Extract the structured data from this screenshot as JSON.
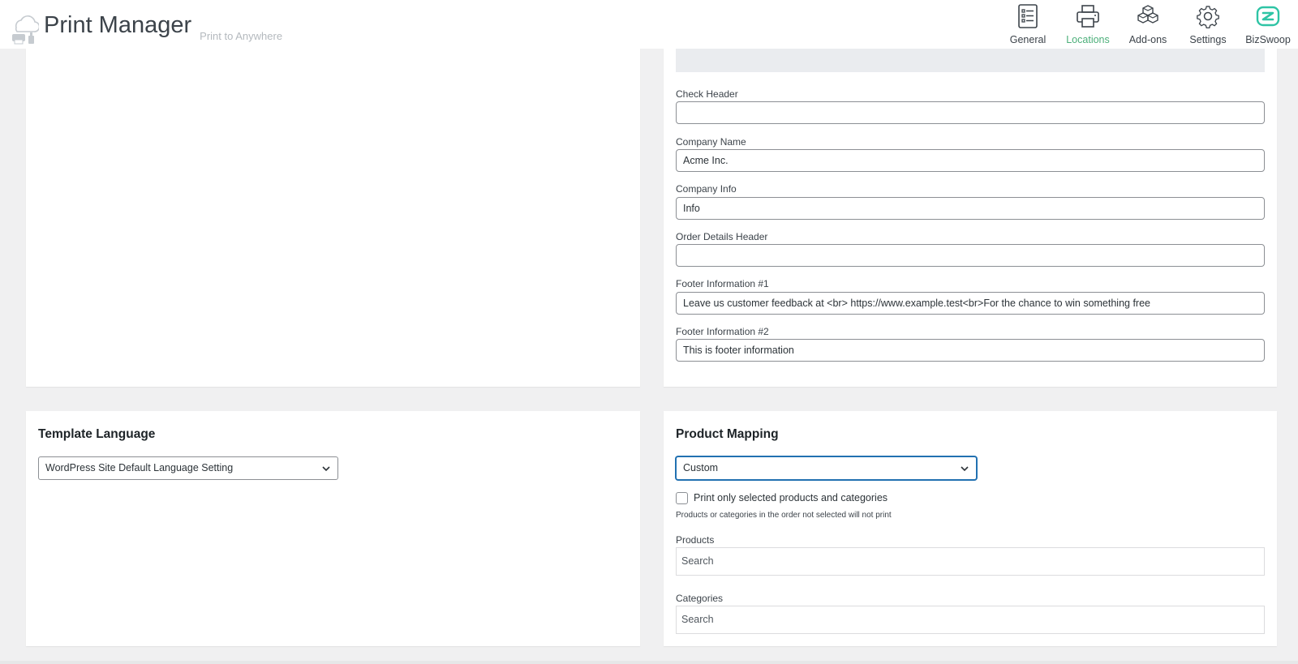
{
  "header": {
    "app_title": "Print Manager",
    "app_subtitle": "Print to Anywhere",
    "nav": [
      {
        "label": "General",
        "icon": "list-icon"
      },
      {
        "label": "Locations",
        "icon": "printer-icon",
        "active": true
      },
      {
        "label": "Add-ons",
        "icon": "cubes-icon"
      },
      {
        "label": "Settings",
        "icon": "gear-icon"
      },
      {
        "label": "BizSwoop",
        "icon": "bizswoop-logo-icon"
      }
    ]
  },
  "template_fields": {
    "check_header": {
      "label": "Check Header",
      "value": ""
    },
    "company_name": {
      "label": "Company Name",
      "value": "Acme Inc."
    },
    "company_info": {
      "label": "Company Info",
      "value": "Info"
    },
    "order_details_header": {
      "label": "Order Details Header",
      "value": ""
    },
    "footer_1": {
      "label": "Footer Information #1",
      "value": "Leave us customer feedback at <br> https://www.example.test<br>For the chance to win something free"
    },
    "footer_2": {
      "label": "Footer Information #2",
      "value": "This is footer information"
    }
  },
  "template_language": {
    "title": "Template Language",
    "selected": "WordPress Site Default Language Setting"
  },
  "product_mapping": {
    "title": "Product Mapping",
    "selected": "Custom",
    "checkbox_label": "Print only selected products and categories",
    "checkbox_checked": false,
    "hint": "Products or categories in the order not selected will not print",
    "products_label": "Products",
    "products_placeholder": "Search",
    "categories_label": "Categories",
    "categories_placeholder": "Search"
  },
  "colors": {
    "accent": "#4caf7a",
    "focus": "#2271b1",
    "background": "#f0f0f1"
  }
}
